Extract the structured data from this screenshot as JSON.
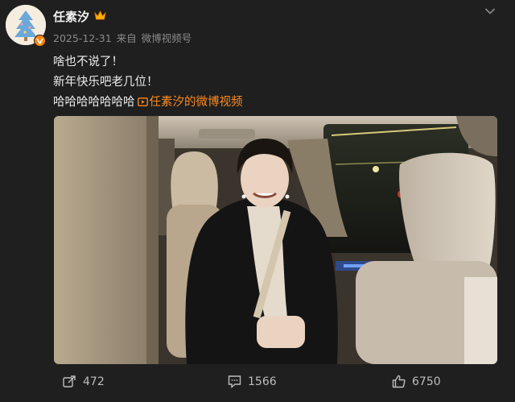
{
  "post": {
    "author": "任素汐",
    "date": "2025-12-31",
    "source_prefix": "来自",
    "source": "微博视频号",
    "lines": [
      "啥也不说了！",
      "新年快乐吧老几位！",
      "哈哈哈哈哈哈哈"
    ],
    "video_link_text": "任素汐的微博视频"
  },
  "icons": {
    "verified": "verified-badge-icon",
    "vip": "crown-icon",
    "expand": "chevron-down-icon",
    "link": "video-link-icon",
    "repost": "repost-icon",
    "comment": "comment-icon",
    "like": "like-icon"
  },
  "actions": {
    "repost_count": "472",
    "comment_count": "1566",
    "like_count": "6750"
  },
  "colors": {
    "background": "#1f1f1f",
    "link": "#ff8a1f",
    "verified": "#ff8200",
    "meta": "#8a8a8a"
  }
}
